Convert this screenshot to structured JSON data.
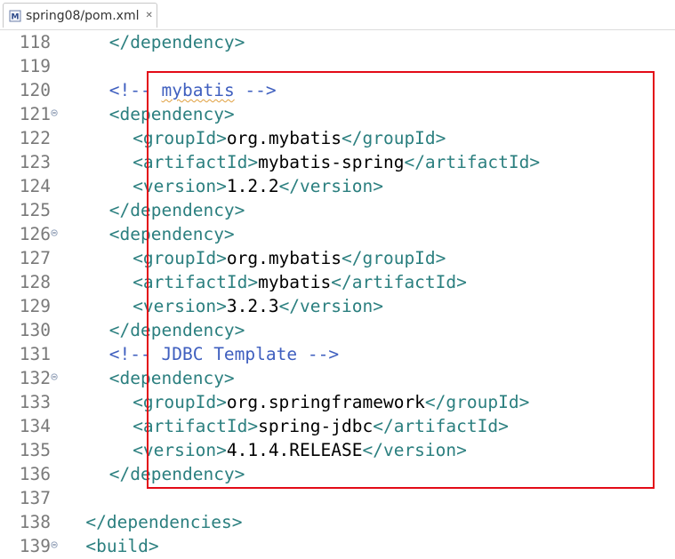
{
  "tab": {
    "icon": "maven-pom-icon",
    "label": "spring08/pom.xml",
    "close_glyph": "✕"
  },
  "annotation": {
    "color": "#e30b17",
    "from_line": "120",
    "to_line": "136"
  },
  "lines": [
    {
      "n": "118",
      "fold": false,
      "indent": 4,
      "parts": [
        {
          "t": "</dependency>",
          "c": "tag"
        }
      ]
    },
    {
      "n": "119",
      "fold": false,
      "indent": 0,
      "parts": []
    },
    {
      "n": "120",
      "fold": false,
      "indent": 4,
      "parts": [
        {
          "t": "<!-- ",
          "c": "cmt"
        },
        {
          "t": "mybatis",
          "c": "cmt",
          "sq": true
        },
        {
          "t": " -->",
          "c": "cmt"
        }
      ]
    },
    {
      "n": "121",
      "fold": true,
      "indent": 4,
      "parts": [
        {
          "t": "<dependency>",
          "c": "tag"
        }
      ]
    },
    {
      "n": "122",
      "fold": false,
      "indent": 6,
      "parts": [
        {
          "t": "<groupId>",
          "c": "tag"
        },
        {
          "t": "org.mybatis",
          "c": "txt"
        },
        {
          "t": "</groupId>",
          "c": "tag"
        }
      ]
    },
    {
      "n": "123",
      "fold": false,
      "indent": 6,
      "parts": [
        {
          "t": "<artifactId>",
          "c": "tag"
        },
        {
          "t": "mybatis-spring",
          "c": "txt"
        },
        {
          "t": "</artifactId>",
          "c": "tag"
        }
      ]
    },
    {
      "n": "124",
      "fold": false,
      "indent": 6,
      "parts": [
        {
          "t": "<version>",
          "c": "tag"
        },
        {
          "t": "1.2.2",
          "c": "txt"
        },
        {
          "t": "</version>",
          "c": "tag"
        }
      ]
    },
    {
      "n": "125",
      "fold": false,
      "indent": 4,
      "parts": [
        {
          "t": "</dependency>",
          "c": "tag"
        }
      ]
    },
    {
      "n": "126",
      "fold": true,
      "indent": 4,
      "parts": [
        {
          "t": "<dependency>",
          "c": "tag"
        }
      ]
    },
    {
      "n": "127",
      "fold": false,
      "indent": 6,
      "parts": [
        {
          "t": "<groupId>",
          "c": "tag"
        },
        {
          "t": "org.mybatis",
          "c": "txt"
        },
        {
          "t": "</groupId>",
          "c": "tag"
        }
      ]
    },
    {
      "n": "128",
      "fold": false,
      "indent": 6,
      "parts": [
        {
          "t": "<artifactId>",
          "c": "tag"
        },
        {
          "t": "mybatis",
          "c": "txt"
        },
        {
          "t": "</artifactId>",
          "c": "tag"
        }
      ]
    },
    {
      "n": "129",
      "fold": false,
      "indent": 6,
      "parts": [
        {
          "t": "<version>",
          "c": "tag"
        },
        {
          "t": "3.2.3",
          "c": "txt"
        },
        {
          "t": "</version>",
          "c": "tag"
        }
      ]
    },
    {
      "n": "130",
      "fold": false,
      "indent": 4,
      "parts": [
        {
          "t": "</dependency>",
          "c": "tag"
        }
      ]
    },
    {
      "n": "131",
      "fold": false,
      "indent": 4,
      "parts": [
        {
          "t": "<!-- JDBC Template -->",
          "c": "cmt"
        }
      ]
    },
    {
      "n": "132",
      "fold": true,
      "indent": 4,
      "parts": [
        {
          "t": "<dependency>",
          "c": "tag"
        }
      ]
    },
    {
      "n": "133",
      "fold": false,
      "indent": 6,
      "parts": [
        {
          "t": "<groupId>",
          "c": "tag"
        },
        {
          "t": "org.springframework",
          "c": "txt"
        },
        {
          "t": "</groupId>",
          "c": "tag"
        }
      ]
    },
    {
      "n": "134",
      "fold": false,
      "indent": 6,
      "parts": [
        {
          "t": "<artifactId>",
          "c": "tag"
        },
        {
          "t": "spring-jdbc",
          "c": "txt"
        },
        {
          "t": "</artifactId>",
          "c": "tag"
        }
      ]
    },
    {
      "n": "135",
      "fold": false,
      "indent": 6,
      "parts": [
        {
          "t": "<version>",
          "c": "tag"
        },
        {
          "t": "4.1.4.RELEASE",
          "c": "txt"
        },
        {
          "t": "</version>",
          "c": "tag"
        }
      ]
    },
    {
      "n": "136",
      "fold": false,
      "indent": 4,
      "parts": [
        {
          "t": "</dependency>",
          "c": "tag"
        }
      ]
    },
    {
      "n": "137",
      "fold": false,
      "indent": 0,
      "parts": []
    },
    {
      "n": "138",
      "fold": false,
      "indent": 2,
      "parts": [
        {
          "t": "</dependencies>",
          "c": "tag"
        }
      ]
    },
    {
      "n": "139",
      "fold": true,
      "indent": 2,
      "parts": [
        {
          "t": "<build>",
          "c": "tag"
        }
      ]
    }
  ]
}
